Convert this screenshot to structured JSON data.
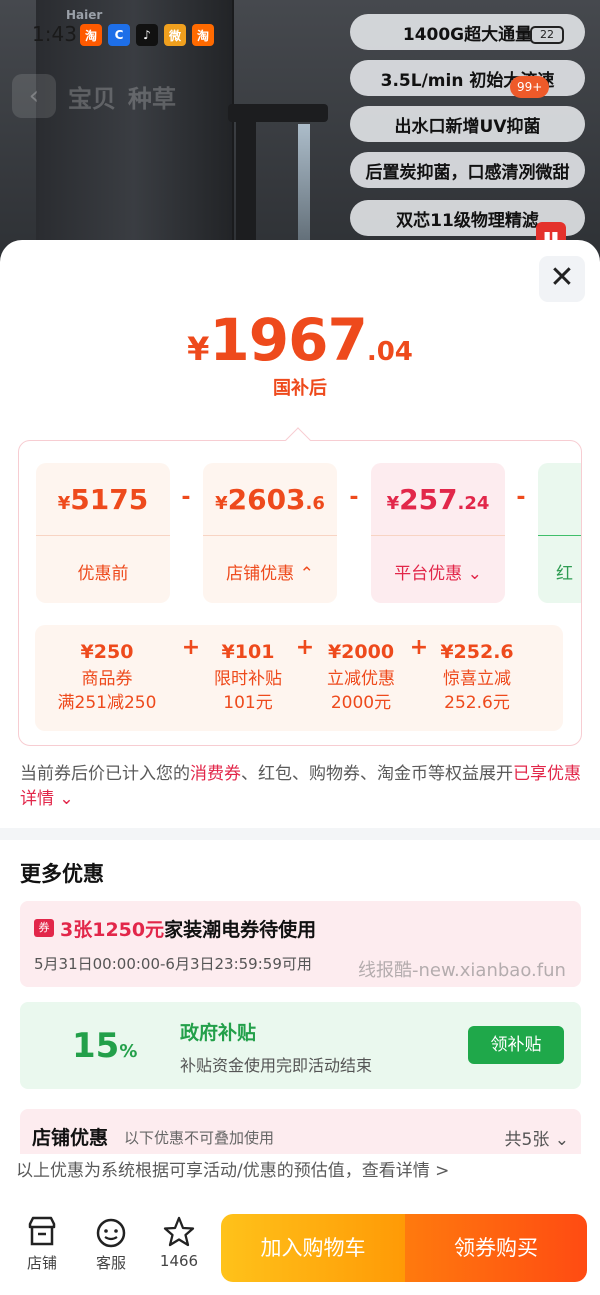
{
  "status_bar": {
    "time": "1:43",
    "app_badges": [
      "淘",
      "C",
      "♪",
      "微",
      "淘"
    ],
    "battery": "22"
  },
  "background": {
    "brand": "Haier",
    "back_label": "‹",
    "tabs": [
      "宝贝",
      "种草"
    ],
    "cart_badge": "99+",
    "features": [
      "1400G超大通量",
      "3.5L/min 初始大流速",
      "出水口新增UV抑菌",
      "后置炭抑菌，口感清冽微甜",
      "双芯11级物理精滤"
    ]
  },
  "sheet": {
    "close_label": "✕",
    "price": {
      "currency": "¥",
      "integer": "1967",
      "decimal": ".04",
      "caption": "国补后"
    },
    "tiles": [
      {
        "yen": "¥",
        "int": "5175",
        "dec": "",
        "label": "优惠前"
      },
      {
        "yen": "¥",
        "int": "2603",
        "dec": ".6",
        "label": "店铺优惠 ⌃"
      },
      {
        "yen": "¥",
        "int": "257",
        "dec": ".24",
        "label": "平台优惠 ⌄"
      },
      {
        "yen": "¥",
        "int": "",
        "dec": "",
        "label": "红"
      }
    ],
    "minus_sign": "-",
    "plus_sign": "+",
    "breakdown": [
      {
        "amount": "¥250",
        "name": "商品券",
        "sub": "满251减250"
      },
      {
        "amount": "¥101",
        "name": "限时补贴",
        "sub": "101元"
      },
      {
        "amount": "¥2000",
        "name": "立减优惠",
        "sub": "2000元"
      },
      {
        "amount": "¥252.6",
        "name": "惊喜立减",
        "sub": "252.6元"
      }
    ],
    "note": {
      "prefix": "当前券后价已计入您的",
      "highlight": "消费券",
      "middle": "、红包、购物券、淘金币等权益展开",
      "link": "已享优惠详情 ⌄"
    },
    "more_title": "更多优惠",
    "coupon": {
      "icon": "券",
      "highlight": "3张1250元",
      "text": "家装潮电券待使用",
      "time": "5月31日00:00:00-6月3日23:59:59可用"
    },
    "watermark": "线报酷-new.xianbao.fun",
    "gov_subsidy": {
      "percent": "15",
      "percent_sign": "%",
      "title": "政府补贴",
      "desc": "补贴资金使用完即活动结束",
      "button": "领补贴"
    },
    "shop_discount": {
      "title": "店铺优惠",
      "desc": "以下优惠不可叠加使用",
      "count": "共5张 ⌄"
    },
    "footer_note": "以上优惠为系统根据可享活动/优惠的预估值，查看详情 >"
  },
  "bottom_bar": {
    "store": "店铺",
    "service": "客服",
    "favorites": "1466",
    "add_to_cart": "加入购物车",
    "buy_with_coupon": "领券购买"
  }
}
